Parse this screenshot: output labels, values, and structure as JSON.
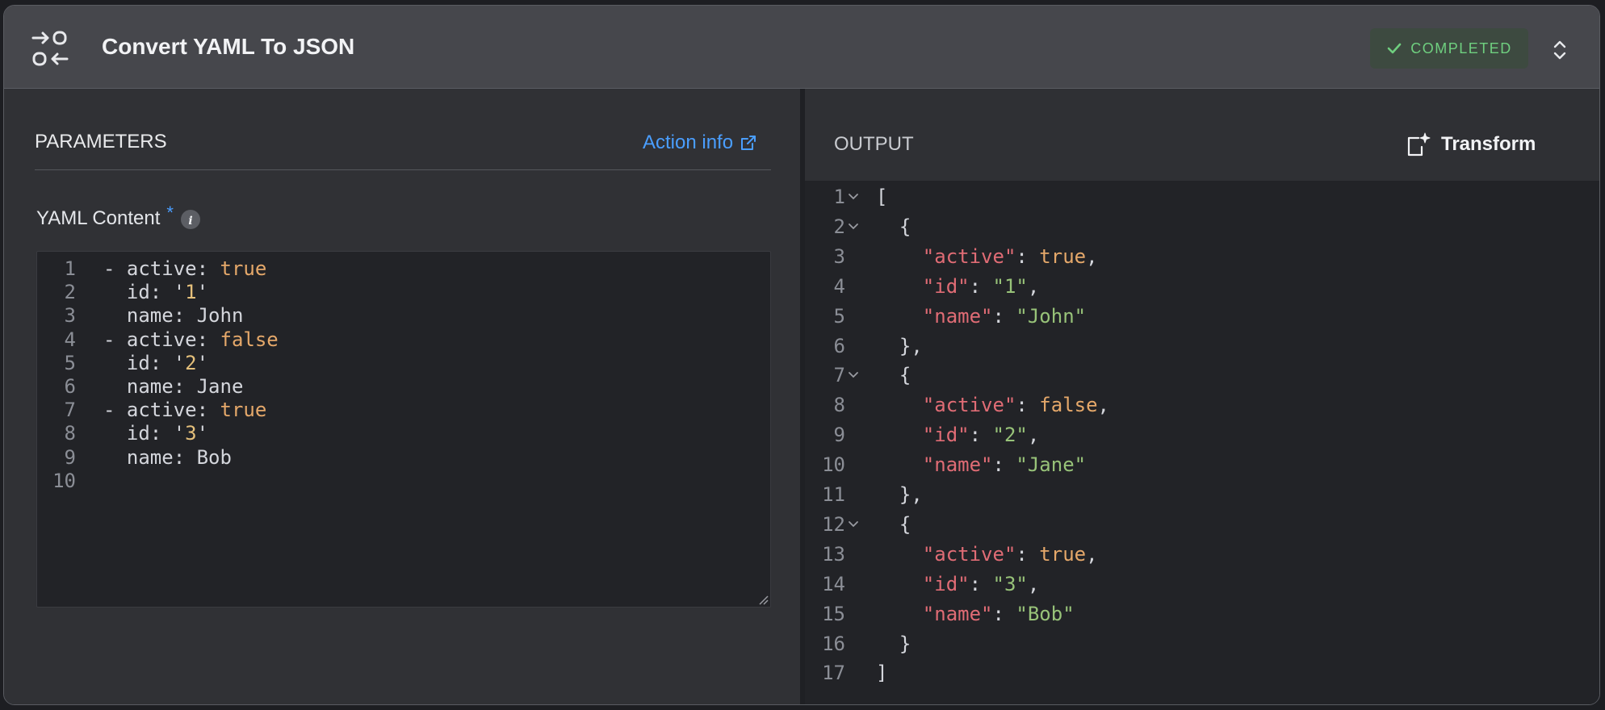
{
  "header": {
    "title": "Convert YAML To JSON",
    "status": "COMPLETED"
  },
  "parameters": {
    "title": "PARAMETERS",
    "action_info": "Action info",
    "field_label": "YAML Content",
    "required_mark": "*",
    "yaml_lines": [
      {
        "n": "1",
        "pre": "- active: ",
        "val": "true",
        "cls": "b"
      },
      {
        "n": "2",
        "pre": "  id: '",
        "val": "1",
        "cls": "q",
        "post": "'"
      },
      {
        "n": "3",
        "pre": "  name: John"
      },
      {
        "n": "4",
        "pre": "- active: ",
        "val": "false",
        "cls": "b"
      },
      {
        "n": "5",
        "pre": "  id: '",
        "val": "2",
        "cls": "q",
        "post": "'"
      },
      {
        "n": "6",
        "pre": "  name: Jane"
      },
      {
        "n": "7",
        "pre": "- active: ",
        "val": "true",
        "cls": "b"
      },
      {
        "n": "8",
        "pre": "  id: '",
        "val": "3",
        "cls": "q",
        "post": "'"
      },
      {
        "n": "9",
        "pre": "  name: Bob"
      },
      {
        "n": "10",
        "pre": ""
      }
    ]
  },
  "output": {
    "title": "OUTPUT",
    "transform_label": "Transform",
    "json_lines": [
      {
        "n": "1",
        "fold": true,
        "parts": [
          [
            "",
            "["
          ]
        ]
      },
      {
        "n": "2",
        "fold": true,
        "parts": [
          [
            "",
            "  {"
          ]
        ]
      },
      {
        "n": "3",
        "parts": [
          [
            "",
            "    "
          ],
          [
            "k",
            "\"active\""
          ],
          [
            "",
            ": "
          ],
          [
            "b",
            "true"
          ],
          [
            "",
            ","
          ]
        ]
      },
      {
        "n": "4",
        "parts": [
          [
            "",
            "    "
          ],
          [
            "k",
            "\"id\""
          ],
          [
            "",
            ": "
          ],
          [
            "s",
            "\"1\""
          ],
          [
            "",
            ","
          ]
        ]
      },
      {
        "n": "5",
        "parts": [
          [
            "",
            "    "
          ],
          [
            "k",
            "\"name\""
          ],
          [
            "",
            ": "
          ],
          [
            "s",
            "\"John\""
          ]
        ]
      },
      {
        "n": "6",
        "parts": [
          [
            "",
            "  },"
          ]
        ]
      },
      {
        "n": "7",
        "fold": true,
        "parts": [
          [
            "",
            "  {"
          ]
        ]
      },
      {
        "n": "8",
        "parts": [
          [
            "",
            "    "
          ],
          [
            "k",
            "\"active\""
          ],
          [
            "",
            ": "
          ],
          [
            "b",
            "false"
          ],
          [
            "",
            ","
          ]
        ]
      },
      {
        "n": "9",
        "parts": [
          [
            "",
            "    "
          ],
          [
            "k",
            "\"id\""
          ],
          [
            "",
            ": "
          ],
          [
            "s",
            "\"2\""
          ],
          [
            "",
            ","
          ]
        ]
      },
      {
        "n": "10",
        "parts": [
          [
            "",
            "    "
          ],
          [
            "k",
            "\"name\""
          ],
          [
            "",
            ": "
          ],
          [
            "s",
            "\"Jane\""
          ]
        ]
      },
      {
        "n": "11",
        "parts": [
          [
            "",
            "  },"
          ]
        ]
      },
      {
        "n": "12",
        "fold": true,
        "parts": [
          [
            "",
            "  {"
          ]
        ]
      },
      {
        "n": "13",
        "parts": [
          [
            "",
            "    "
          ],
          [
            "k",
            "\"active\""
          ],
          [
            "",
            ": "
          ],
          [
            "b",
            "true"
          ],
          [
            "",
            ","
          ]
        ]
      },
      {
        "n": "14",
        "parts": [
          [
            "",
            "    "
          ],
          [
            "k",
            "\"id\""
          ],
          [
            "",
            ": "
          ],
          [
            "s",
            "\"3\""
          ],
          [
            "",
            ","
          ]
        ]
      },
      {
        "n": "15",
        "parts": [
          [
            "",
            "    "
          ],
          [
            "k",
            "\"name\""
          ],
          [
            "",
            ": "
          ],
          [
            "s",
            "\"Bob\""
          ]
        ]
      },
      {
        "n": "16",
        "parts": [
          [
            "",
            "  }"
          ]
        ]
      },
      {
        "n": "17",
        "parts": [
          [
            "",
            "]"
          ]
        ]
      }
    ]
  },
  "colors": {
    "accent": "#4a9eff",
    "status_green": "#6fcf7f",
    "json_key": "#e06c75",
    "json_string": "#98c379",
    "literal": "#e5a86a"
  },
  "icons": [
    "convert-icon",
    "check-icon",
    "expand-collapse-icon",
    "external-link-icon",
    "info-icon",
    "transform-icon",
    "chevron-down-icon",
    "resize-handle-icon"
  ]
}
